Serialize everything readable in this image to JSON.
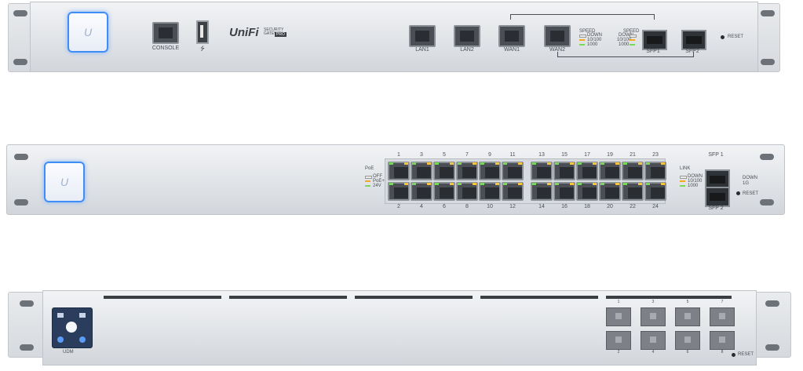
{
  "gateway": {
    "brand_logo": "UniFi",
    "model_label": "SECURITY GATEWAY",
    "model_badge": "PRO",
    "console_label": "CONSOLE",
    "usb_label": "⭍",
    "port_labels": [
      "LAN1",
      "LAN2",
      "WAN1",
      "WAN2"
    ],
    "sfp_labels": [
      "SFP1",
      "SFP2"
    ],
    "speed_legend_title": "SPEED",
    "speed_legend": [
      "DOWN",
      "10/100",
      "1000"
    ],
    "sfp_speed_legend": [
      "DOWN",
      "10/100",
      "1000"
    ],
    "reset_label": "RESET"
  },
  "switch": {
    "poe_label": "PoE",
    "poe_legend": [
      "OFF",
      "PoE+",
      "24V"
    ],
    "odd_ports": [
      "1",
      "3",
      "5",
      "7",
      "9",
      "11",
      "13",
      "15",
      "17",
      "19",
      "21",
      "23"
    ],
    "even_ports": [
      "2",
      "4",
      "6",
      "8",
      "10",
      "12",
      "14",
      "16",
      "18",
      "20",
      "22",
      "24"
    ],
    "link_label": "LINK",
    "link_legend": [
      "DOWN",
      "10/100",
      "1000"
    ],
    "sfp_top_label": "SFP 1",
    "sfp_bottom_label": "SFP 2",
    "sfp_legend": [
      "DOWN",
      "1G"
    ],
    "reset_label": "RESET"
  },
  "aggregation": {
    "status_label": "UDM",
    "reset_label": "RESET",
    "port_numbers_top": [
      "1",
      "3",
      "5",
      "7"
    ],
    "port_numbers_bottom": [
      "2",
      "4",
      "6",
      "8"
    ]
  },
  "colors": {
    "accent_blue": "#3f8ef5",
    "led_green": "#79d85c",
    "led_amber": "#f5a623",
    "led_white": "#e9ebed"
  }
}
